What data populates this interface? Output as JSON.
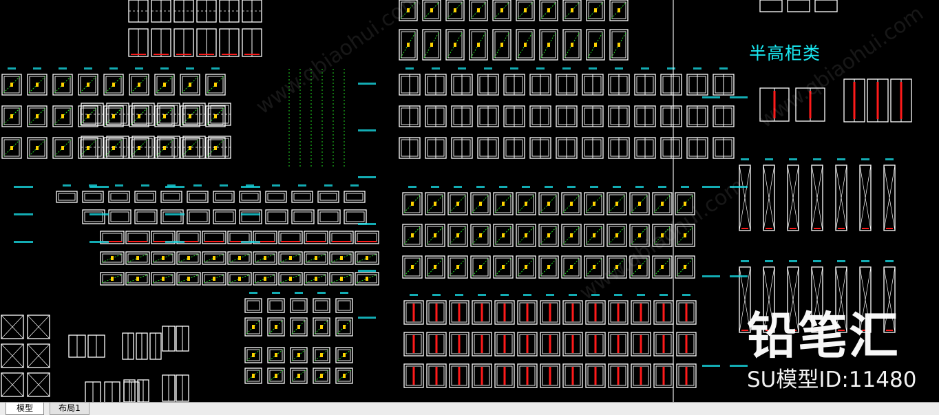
{
  "drawing": {
    "section_title": "半高柜类",
    "watermark_brand": "铅笔汇",
    "watermark_id": "SU模型ID:11480",
    "watermark_site": "www.qbiaohui.com"
  },
  "tabs": [
    {
      "label": "模型",
      "active": true
    },
    {
      "label": "布局1",
      "active": false
    }
  ],
  "colors": {
    "background": "#000000",
    "outline": "#ffffff",
    "annotation": "#19e6ef",
    "accent_red": "#ff1a1a",
    "accent_green": "#22dd22",
    "accent_yellow": "#ffd200",
    "tabbar": "#ececec"
  }
}
